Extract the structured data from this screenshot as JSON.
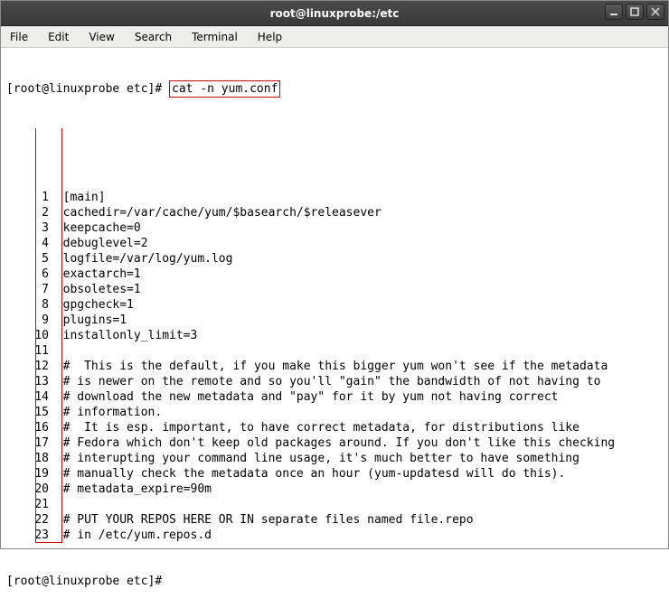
{
  "window": {
    "title": "root@linuxprobe:/etc"
  },
  "menu": {
    "file": "File",
    "edit": "Edit",
    "view": "View",
    "search": "Search",
    "terminal": "Terminal",
    "help": "Help"
  },
  "prompt": {
    "text": "[root@linuxprobe etc]# ",
    "command": "cat -n yum.conf"
  },
  "output": {
    "lines": [
      {
        "n": "1",
        "t": "[main]"
      },
      {
        "n": "2",
        "t": "cachedir=/var/cache/yum/$basearch/$releasever"
      },
      {
        "n": "3",
        "t": "keepcache=0"
      },
      {
        "n": "4",
        "t": "debuglevel=2"
      },
      {
        "n": "5",
        "t": "logfile=/var/log/yum.log"
      },
      {
        "n": "6",
        "t": "exactarch=1"
      },
      {
        "n": "7",
        "t": "obsoletes=1"
      },
      {
        "n": "8",
        "t": "gpgcheck=1"
      },
      {
        "n": "9",
        "t": "plugins=1"
      },
      {
        "n": "10",
        "t": "installonly_limit=3"
      },
      {
        "n": "11",
        "t": ""
      },
      {
        "n": "12",
        "t": "#  This is the default, if you make this bigger yum won't see if the metadata "
      },
      {
        "n": "13",
        "t": "# is newer on the remote and so you'll \"gain\" the bandwidth of not having to"
      },
      {
        "n": "14",
        "t": "# download the new metadata and \"pay\" for it by yum not having correct"
      },
      {
        "n": "15",
        "t": "# information."
      },
      {
        "n": "16",
        "t": "#  It is esp. important, to have correct metadata, for distributions like"
      },
      {
        "n": "17",
        "t": "# Fedora which don't keep old packages around. If you don't like this checking"
      },
      {
        "n": "18",
        "t": "# interupting your command line usage, it's much better to have something"
      },
      {
        "n": "19",
        "t": "# manually check the metadata once an hour (yum-updatesd will do this)."
      },
      {
        "n": "20",
        "t": "# metadata_expire=90m"
      },
      {
        "n": "21",
        "t": ""
      },
      {
        "n": "22",
        "t": "# PUT YOUR REPOS HERE OR IN separate files named file.repo"
      },
      {
        "n": "23",
        "t": "# in /etc/yum.repos.d"
      }
    ]
  },
  "prompt2": {
    "text": "[root@linuxprobe etc]#"
  }
}
